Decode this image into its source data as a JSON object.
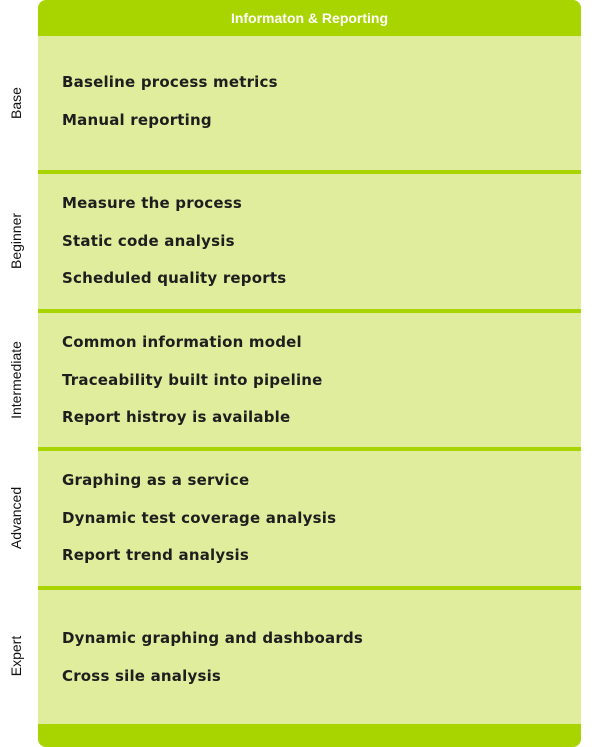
{
  "header": {
    "title": "Informaton & Reporting"
  },
  "levels": [
    {
      "name": "Base",
      "items": [
        "Baseline process metrics",
        "Manual reporting"
      ]
    },
    {
      "name": "Beginner",
      "items": [
        "Measure the process",
        "Static code analysis",
        "Scheduled quality reports"
      ]
    },
    {
      "name": "Intermediate",
      "items": [
        "Common information model",
        "Traceability built into pipeline",
        "Report histroy is available"
      ]
    },
    {
      "name": "Advanced",
      "items": [
        "Graphing as a service",
        "Dynamic test coverage analysis",
        "Report trend analysis"
      ]
    },
    {
      "name": "Expert",
      "items": [
        "Dynamic graphing and dashboards",
        "Cross sile analysis"
      ]
    }
  ],
  "colors": {
    "accent": "#a8d400",
    "band": "#e0ed9c",
    "text": "#1e1e1e"
  }
}
